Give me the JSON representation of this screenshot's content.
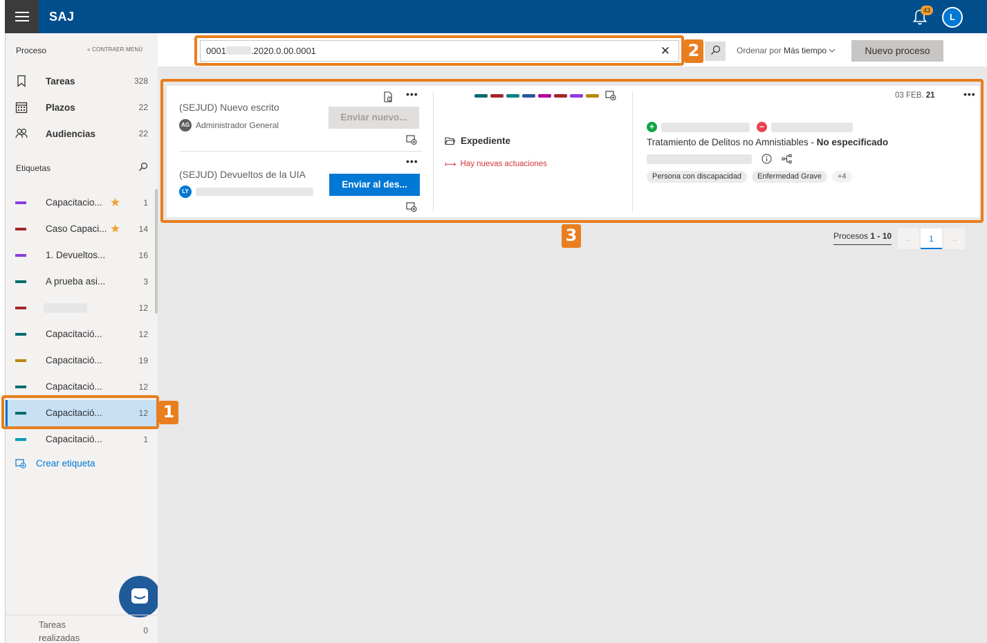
{
  "app": {
    "title": "SAJ",
    "notifications_count": "43",
    "user_initial": "L"
  },
  "sidebar": {
    "header": "Proceso",
    "collapse_label": "« CONTRAER MENÚ",
    "nav": [
      {
        "label": "Tareas",
        "count": "328",
        "icon": "bookmark-icon"
      },
      {
        "label": "Plazos",
        "count": "22",
        "icon": "calendar-icon"
      },
      {
        "label": "Audiencias",
        "count": "22",
        "icon": "people-icon"
      }
    ],
    "tags_header": "Etiquetas",
    "tags": [
      {
        "label": "Capacitacio...",
        "count": "1",
        "color": "#8a3ee0",
        "starred": true
      },
      {
        "label": "Caso Capaci...",
        "count": "14",
        "color": "#a4262c",
        "starred": true
      },
      {
        "label": "1. Devueltos...",
        "count": "16",
        "color": "#8a3ee0",
        "starred": false
      },
      {
        "label": "A prueba asi...",
        "count": "3",
        "color": "#036c70",
        "starred": false
      },
      {
        "label": "",
        "count": "12",
        "color": "#a4262c",
        "starred": false,
        "redacted": true
      },
      {
        "label": "Capacitació...",
        "count": "12",
        "color": "#036c70",
        "starred": false
      },
      {
        "label": "Capacitació...",
        "count": "19",
        "color": "#b8860b",
        "starred": false
      },
      {
        "label": "Capacitació...",
        "count": "12",
        "color": "#036c70",
        "starred": false
      },
      {
        "label": "Capacitació...",
        "count": "12",
        "color": "#036c70",
        "starred": false,
        "selected": true
      },
      {
        "label": "Capacitació...",
        "count": "1",
        "color": "#0099bc",
        "starred": false
      }
    ],
    "create_tag_label": "Crear etiqueta",
    "footer": {
      "label": "Tareas realizadas",
      "count": "0"
    }
  },
  "toolbar": {
    "search_value_prefix": "0001",
    "search_value_suffix": ".2020.0.00.0001",
    "sort_label": "Ordenar por",
    "sort_value": "Más tiempo",
    "new_process_label": "Nuevo proceso"
  },
  "card": {
    "tasks": [
      {
        "title": "(SEJUD) Nuevo escrito",
        "assignee": "Administrador General",
        "avatar": "AG",
        "avatar_color": "#605e5c",
        "button": "Enviar nuevo...",
        "button_enabled": false
      },
      {
        "title": "(SEJUD) Devueltos de la UIA",
        "assignee": "",
        "avatar": "LY",
        "avatar_color": "#0078d4",
        "button": "Enviar al des...",
        "button_enabled": true
      }
    ],
    "tag_colors": [
      "#036c70",
      "#a4262c",
      "#038387",
      "#2b579a",
      "#b4009e",
      "#a4262c",
      "#8a3ee0",
      "#b8860b"
    ],
    "expediente_label": "Expediente",
    "new_actions_label": "Hay nuevas actuaciones",
    "date_day": "03",
    "date_month": "FEB.",
    "date_year": "21",
    "crime_text": "Tratamiento de Delitos no Amnistiables",
    "crime_separator": " - ",
    "crime_status": "No especificado",
    "chips": [
      "Persona con discapacidad",
      "Enfermedad Grave",
      "+4"
    ]
  },
  "pager": {
    "label_prefix": "Procesos",
    "range": "1 - 10",
    "prev": "←",
    "page": "1",
    "next": "→"
  },
  "callouts": [
    "1",
    "2",
    "3"
  ]
}
